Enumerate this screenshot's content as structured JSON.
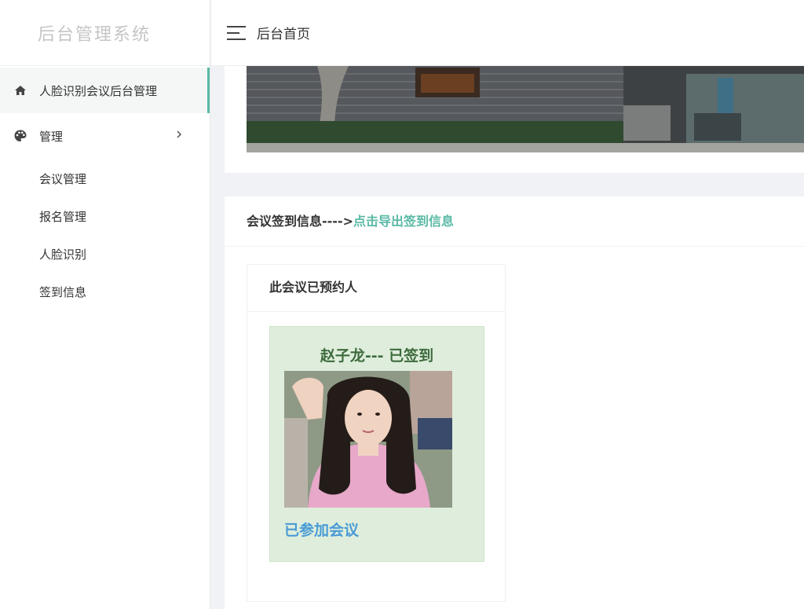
{
  "app": {
    "logo_text": "后台管理系统"
  },
  "sidebar": {
    "items": [
      {
        "label": "人脸识别会议后台管理",
        "icon": "home-icon"
      },
      {
        "label": "管理",
        "icon": "palette-icon"
      }
    ],
    "submenu": [
      {
        "label": "会议管理"
      },
      {
        "label": "报名管理"
      },
      {
        "label": "人脸识别"
      },
      {
        "label": "签到信息"
      }
    ]
  },
  "topbar": {
    "title": "后台首页",
    "menu_icon": "hamburger-icon"
  },
  "info": {
    "header_prefix": "会议签到信息---->",
    "export_link": "点击导出签到信息",
    "panel_title": "此会议已预约人",
    "person": {
      "name_status": "赵子龙--- 已签到",
      "joined_text": "已参加会议"
    }
  },
  "colors": {
    "accent": "#5ab9a6",
    "card_green": "#dfeedc",
    "joined_blue": "#4a9bd6"
  }
}
